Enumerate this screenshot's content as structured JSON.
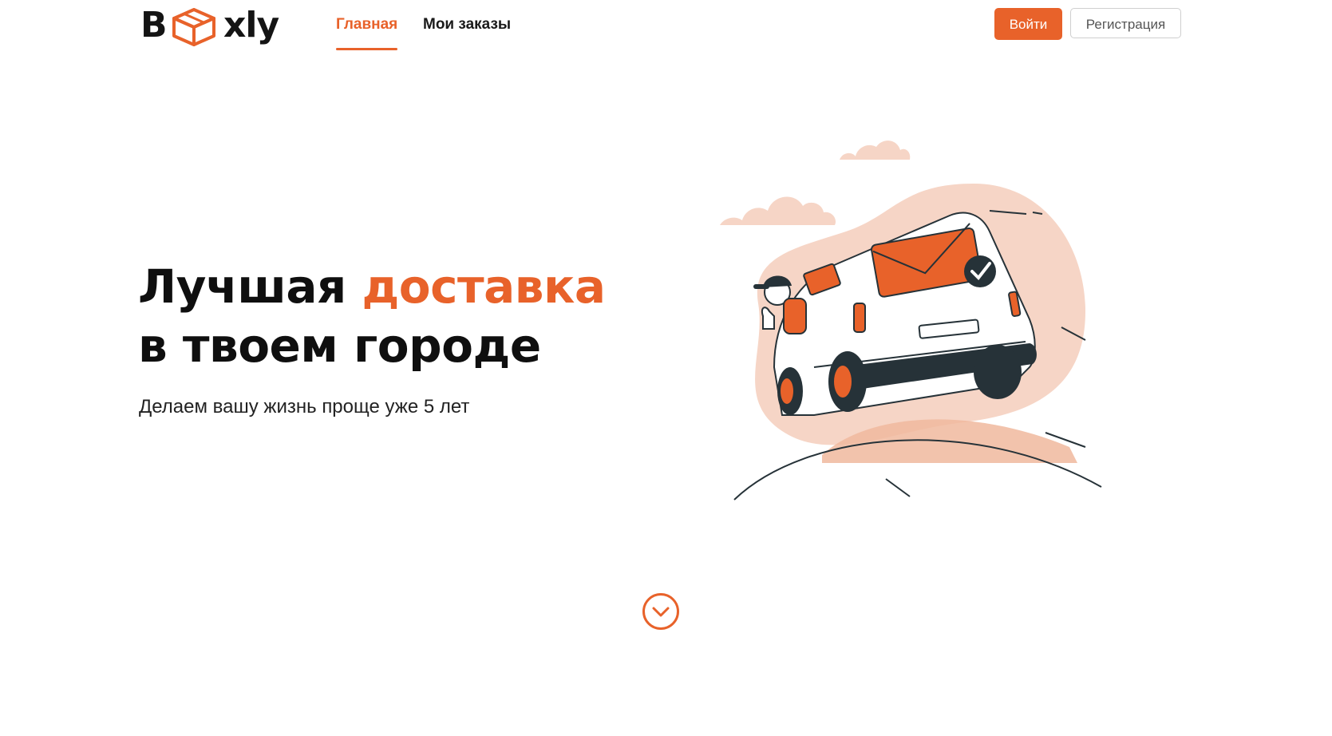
{
  "header": {
    "logo": {
      "letter_b": "B",
      "rest": "xly",
      "box_icon": "box-icon"
    },
    "nav": [
      {
        "label": "Главная",
        "active": true
      },
      {
        "label": "Мои заказы",
        "active": false
      }
    ],
    "login_label": "Войти",
    "register_label": "Регистрация"
  },
  "hero": {
    "title_line1_start": "Лучшая ",
    "title_line1_accent": "доставка",
    "title_line2": "в твоем городе",
    "subtitle": "Делаем вашу жизнь проще уже 5 лет"
  },
  "scroll_icon": "chevron-down-circle-icon",
  "colors": {
    "accent": "#e8622a",
    "text": "#0f0f0f",
    "illustration_blob": "#f6d5c6",
    "illustration_dark": "#263238"
  }
}
